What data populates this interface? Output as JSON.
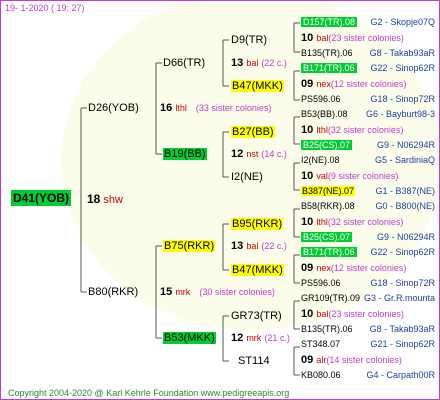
{
  "header": {
    "date": "19-  1-2020  ( 19: 27)"
  },
  "footer": {
    "copyright": "Copyright 2004-2020 @ Karl Kehrle Foundation    www.pedigreeapis.org"
  },
  "root": {
    "name": "D41(YOB)",
    "num": "18",
    "letter": "shw"
  },
  "gen1": [
    {
      "name": "D26(YOB)",
      "num": "16",
      "letter": "lthl",
      "colonies": "(33 sister colonies)"
    },
    {
      "name": "B80(RKR)",
      "num": "15",
      "letter": "mrk",
      "colonies": "(30 sister colonies)"
    }
  ],
  "gen2": [
    {
      "name": "D66(TR)"
    },
    {
      "name": "B19(BB)"
    },
    {
      "name": "B75(RKR)"
    },
    {
      "name": "B53(MKK)"
    }
  ],
  "gen3": [
    {
      "name": "D9(TR)",
      "num": "13",
      "letter": "bal",
      "colonies": "(22 c.)"
    },
    {
      "name": "B47(MKK)"
    },
    {
      "name": "B27(BB)",
      "num": "12",
      "letter": "nst",
      "colonies": "(14 c.)"
    },
    {
      "name": "I2(NE)"
    },
    {
      "name": "B95(RKR)",
      "num": "13",
      "letter": "bal",
      "colonies": "(22 c.)"
    },
    {
      "name": "B47(MKK)"
    },
    {
      "name": "GR73(TR)",
      "num": "12",
      "letter": "mrk",
      "colonies": "(21 c.)"
    },
    {
      "name": "ST114"
    }
  ],
  "gen4": [
    {
      "top": "D157(TR).08",
      "top_ref": "G2 - Skopje07Q",
      "num": "10",
      "letter": "bal",
      "colonies": "(23 sister colonies)",
      "bottom": "B135(TR).06",
      "bottom_ref": "G8 - Takab93aR"
    },
    {
      "top": "B171(TR).06",
      "top_ref": "G22 - Sinop62R",
      "num": "09",
      "letter": "nex",
      "colonies": "(12 sister colonies)",
      "bottom": "PS596.06",
      "bottom_ref": "G18 - Sinop72R"
    },
    {
      "top": "B53(BB).08",
      "top_ref": "G6 - Bayburt98-3",
      "num": "10",
      "letter": "lthl",
      "colonies": "(32 sister colonies)",
      "bottom": "B25(CS).07",
      "bottom_ref": "G9 - N06294R"
    },
    {
      "top": "I2(NE).08",
      "top_ref": "G5 - SardiniaQ",
      "num": "10",
      "letter": "val",
      "colonies": "(9 sister colonies)",
      "bottom": "B387(NE).07",
      "bottom_ref": "G1 - B387(NE)"
    },
    {
      "top": "B58(RKR).08",
      "top_ref": "G0 - B800(NE)",
      "num": "10",
      "letter": "lthl",
      "colonies": "(32 sister colonies)",
      "bottom": "B25(CS).07",
      "bottom_ref": "G9 - N06294R"
    },
    {
      "top": "B171(TR).06",
      "top_ref": "G22 - Sinop62R",
      "num": "09",
      "letter": "nex",
      "colonies": "(12 sister colonies)",
      "bottom": "PS596.06",
      "bottom_ref": "G18 - Sinop72R"
    },
    {
      "top": "GR109(TR).09",
      "top_ref": "G3 - Gr.R.mounta",
      "num": "10",
      "letter": "bal",
      "colonies": "(23 sister colonies)",
      "bottom": "B135(TR).06",
      "bottom_ref": "G8 - Takab93aR"
    },
    {
      "top": "ST348.07",
      "top_ref": "G21 - Sinop62R",
      "num": "09",
      "letter": "alr",
      "colonies": "(14 sister colonies)",
      "bottom": "KB080.06",
      "bottom_ref": "G4 - Carpath00R"
    }
  ]
}
